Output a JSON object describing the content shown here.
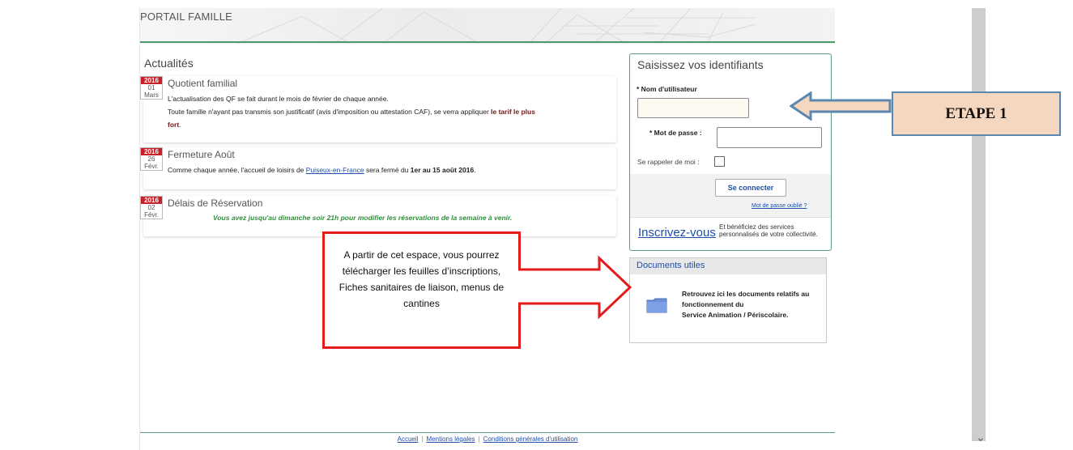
{
  "header": {
    "title": "PORTAIL FAMILLE"
  },
  "news": {
    "section_title": "Actualités",
    "items": [
      {
        "year": "2016",
        "day": "01",
        "month": "Mars",
        "title": "Quotient familial",
        "line1": "L'actualisation des QF se fait durant le mois de février de chaque année.",
        "line2": "Toute famille n'ayant pas transmis son justificatif (avis d'imposition ou attestation CAF), se verra appliquer ",
        "line2_bold": "le tarif le plus",
        "line3_bold": "fort",
        "line3_end": "."
      },
      {
        "year": "2016",
        "day": "26",
        "month": "Févr.",
        "title": "Fermeture Août",
        "text_start": "Comme chaque année, l'accueil de loisirs de ",
        "link": "Puiseux-en-France",
        "text_mid": " sera fermé du ",
        "text_bold": "1er au 15 août 2016",
        "text_end": "."
      },
      {
        "year": "2016",
        "day": "02",
        "month": "Févr.",
        "title": "Délais de Réservation",
        "note": "Vous avez jusqu'au dimanche soir 21h pour modifier les réservations de la semaine à venir."
      }
    ]
  },
  "login": {
    "title": "Saisissez vos identifiants",
    "username_label": "* Nom d'utilisateur",
    "password_label": "* Mot de passe :",
    "remember_label": "Se rappeler de moi :",
    "submit_label": "Se connecter",
    "forgot_link": "Mot de passe oublié ?",
    "register_link": "Inscrivez-vous",
    "register_text": "Et bénéficiez des services personnalisés de votre collectivité."
  },
  "documents": {
    "title": "Documents utiles",
    "text_bold": "Retrouvez ici les documents relatifs au fonctionnement du",
    "text_normal": "Service Animation / Périscolaire."
  },
  "footer": {
    "links": [
      "Accueil",
      "Mentions légales",
      "Conditions générales d'utilisation"
    ]
  },
  "annotations": {
    "etape": "ETAPE 1",
    "red_box_text": "A partir de cet espace, vous pourrez télécharger les feuilles d’inscriptions, Fiches sanitaires de liaison, menus de cantines"
  },
  "colors": {
    "accent_green": "#4a9a6a",
    "date_red": "#c8202a",
    "link_blue": "#1f4fa8",
    "annotation_red": "#e31b1b",
    "etape_fill": "#f5d7bf",
    "etape_border": "#5a87b0"
  }
}
